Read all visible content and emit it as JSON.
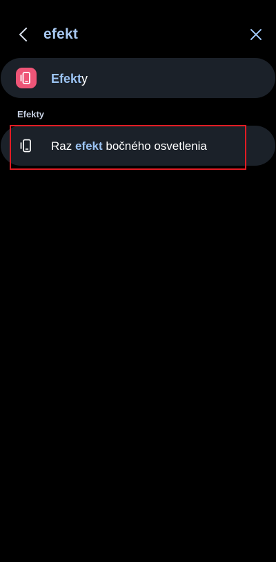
{
  "search": {
    "query": "efekt"
  },
  "top_result": {
    "label_highlight": "Efekt",
    "label_rest": "y",
    "icon": "edge-panel-icon",
    "icon_color": "#ee5577"
  },
  "section": {
    "header": "Efekty"
  },
  "result_item": {
    "label_prefix": "Raz ",
    "label_highlight": "efekt",
    "label_suffix": " bočného osvetlenia",
    "icon": "edge-panel-icon"
  },
  "colors": {
    "background": "#000000",
    "card": "#1b2129",
    "highlight_text": "#9cc4f4",
    "selection_box": "#e21c24"
  }
}
